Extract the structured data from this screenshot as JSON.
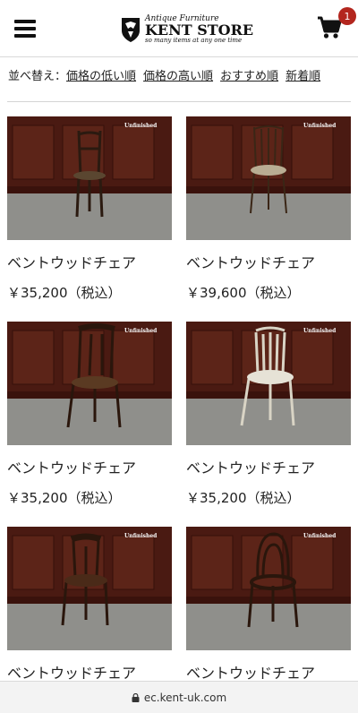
{
  "header": {
    "logo_top": "Antique Furniture",
    "logo_main": "KENT STORE",
    "logo_sub": "so many items at any one time",
    "cart_count": "1"
  },
  "sort": {
    "label": "並べ替え：",
    "options": [
      "価格の低い順",
      "価格の高い順",
      "おすすめ順",
      "新着順"
    ]
  },
  "products": [
    {
      "title": "ベントウッドチェア",
      "price": "￥35,200（税込）",
      "badge": "Unfinished"
    },
    {
      "title": "ベントウッドチェア",
      "price": "￥39,600（税込）",
      "badge": "Unfinished"
    },
    {
      "title": "ベントウッドチェア",
      "price": "￥35,200（税込）",
      "badge": "Unfinished"
    },
    {
      "title": "ベントウッドチェア",
      "price": "￥35,200（税込）",
      "badge": "Unfinished"
    },
    {
      "title": "ベントウッドチェア",
      "price": "",
      "badge": "Unfinished"
    },
    {
      "title": "ベントウッドチェア",
      "price": "",
      "badge": "Unfinished"
    }
  ],
  "browser": {
    "url": "ec.kent-uk.com"
  },
  "colors": {
    "badge": "#b3261e",
    "panel_wood": "#4a1a12",
    "floor": "#8f8f8b"
  }
}
